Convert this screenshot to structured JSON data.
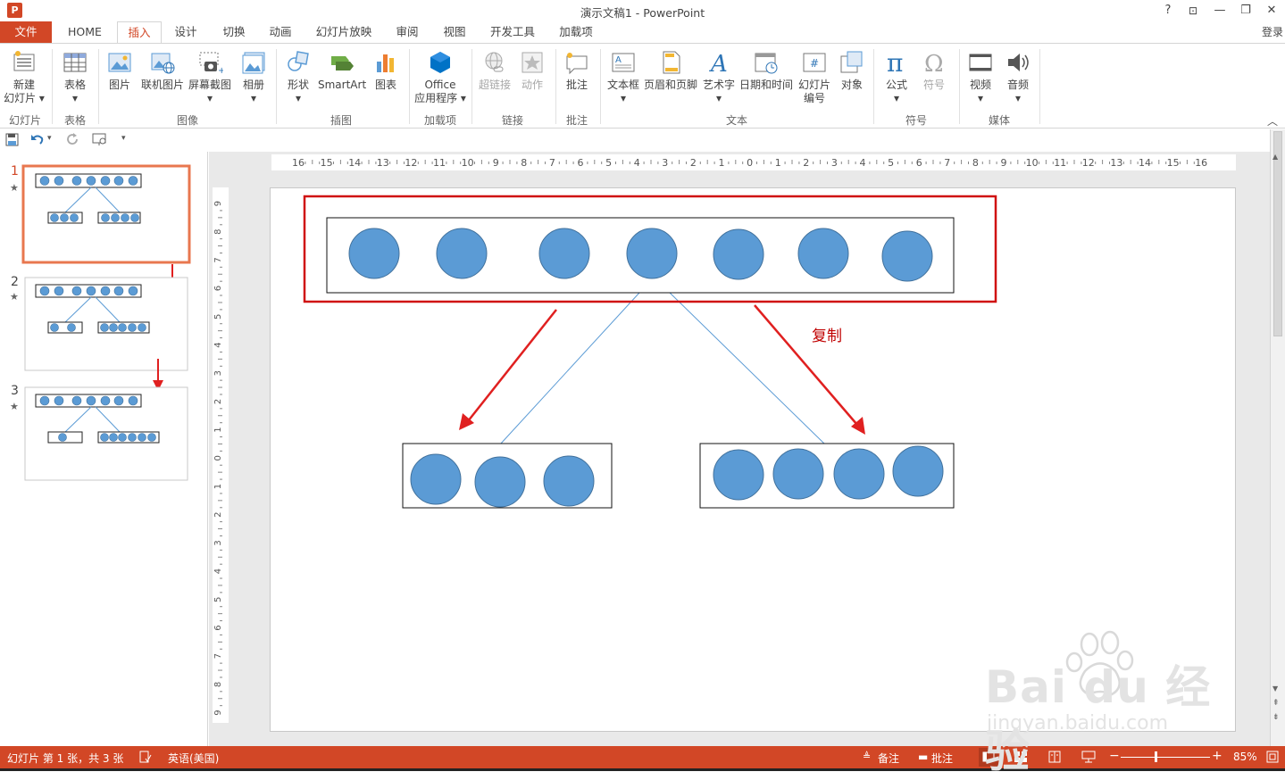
{
  "window": {
    "title": "演示文稿1 - PowerPoint",
    "app_logo": "P",
    "help": "?",
    "restore_ribbon": "⊡",
    "minimize": "—",
    "maximize": "❐",
    "close": "✕"
  },
  "tabs": [
    {
      "label": "文件"
    },
    {
      "label": "HOME"
    },
    {
      "label": "插入"
    },
    {
      "label": "设计"
    },
    {
      "label": "切换"
    },
    {
      "label": "动画"
    },
    {
      "label": "幻灯片放映"
    },
    {
      "label": "审阅"
    },
    {
      "label": "视图"
    },
    {
      "label": "开发工具"
    },
    {
      "label": "加载项"
    }
  ],
  "login": "登录",
  "ribbon": {
    "new_slide": {
      "line1": "新建",
      "line2": "幻灯片 ▾"
    },
    "table": {
      "label": "表格",
      "arrow": "▾"
    },
    "picture": "图片",
    "online_picture": "联机图片",
    "screenshot": {
      "label": "屏幕截图",
      "arrow": "▾"
    },
    "album": {
      "label": "相册",
      "arrow": "▾"
    },
    "shapes": {
      "label": "形状",
      "arrow": "▾"
    },
    "smartart": "SmartArt",
    "chart": "图表",
    "office_apps": {
      "line1": "Office",
      "line2": "应用程序 ▾"
    },
    "hyperlink": "超链接",
    "action": "动作",
    "comment": "批注",
    "textbox": {
      "label": "文本框",
      "arrow": "▾"
    },
    "header_footer": "页眉和页脚",
    "wordart": {
      "label": "艺术字",
      "arrow": "▾"
    },
    "datetime": "日期和时间",
    "slide_number": {
      "line1": "幻灯片",
      "line2": "编号"
    },
    "object": "对象",
    "equation": {
      "label": "公式",
      "arrow": "▾"
    },
    "symbol": "符号",
    "video": {
      "label": "视频",
      "arrow": "▾"
    },
    "audio": {
      "label": "音频",
      "arrow": "▾"
    },
    "groups": {
      "slides": "幻灯片",
      "tables": "表格",
      "images": "图像",
      "illustrations": "插图",
      "addins": "加载项",
      "links": "链接",
      "comments": "批注",
      "text": "文本",
      "symbols": "符号",
      "media": "媒体"
    },
    "collapse": "︿"
  },
  "qat": {
    "save": "save-icon",
    "undo": "undo-icon",
    "undo_arrow": "▾",
    "redo": "redo-icon",
    "present": "present-icon",
    "customize": "▾"
  },
  "thumbnails": [
    {
      "num": "1",
      "star": "★"
    },
    {
      "num": "2",
      "star": "★"
    },
    {
      "num": "3",
      "star": "★"
    }
  ],
  "ruler": {
    "h_ticks": [
      "16",
      "15",
      "14",
      "13",
      "12",
      "11",
      "10",
      "9",
      "8",
      "7",
      "6",
      "5",
      "4",
      "3",
      "2",
      "1",
      "0",
      "1",
      "2",
      "3",
      "4",
      "5",
      "6",
      "7",
      "8",
      "9",
      "10",
      "11",
      "12",
      "13",
      "14",
      "15",
      "16"
    ],
    "v_ticks": [
      "9",
      "8",
      "7",
      "6",
      "5",
      "4",
      "3",
      "2",
      "1",
      "0",
      "1",
      "2",
      "3",
      "4",
      "5",
      "6",
      "7",
      "8",
      "9"
    ]
  },
  "slide": {
    "copy_label": "复制"
  },
  "colors": {
    "accent": "#d24726",
    "circle_fill": "#5b9bd5",
    "circle_stroke": "#41719c",
    "arrow_red": "#e02020",
    "box_red": "#d01010"
  },
  "status": {
    "slide_info": "幻灯片 第 1 张，共 3 张",
    "language": "英语(美国)",
    "notes": "备注",
    "comments": "批注",
    "zoom": "85%",
    "zoom_minus": "−",
    "zoom_plus": "+"
  },
  "watermark": {
    "brand": "Bai du 经验",
    "url": "jingyan.baidu.com"
  }
}
